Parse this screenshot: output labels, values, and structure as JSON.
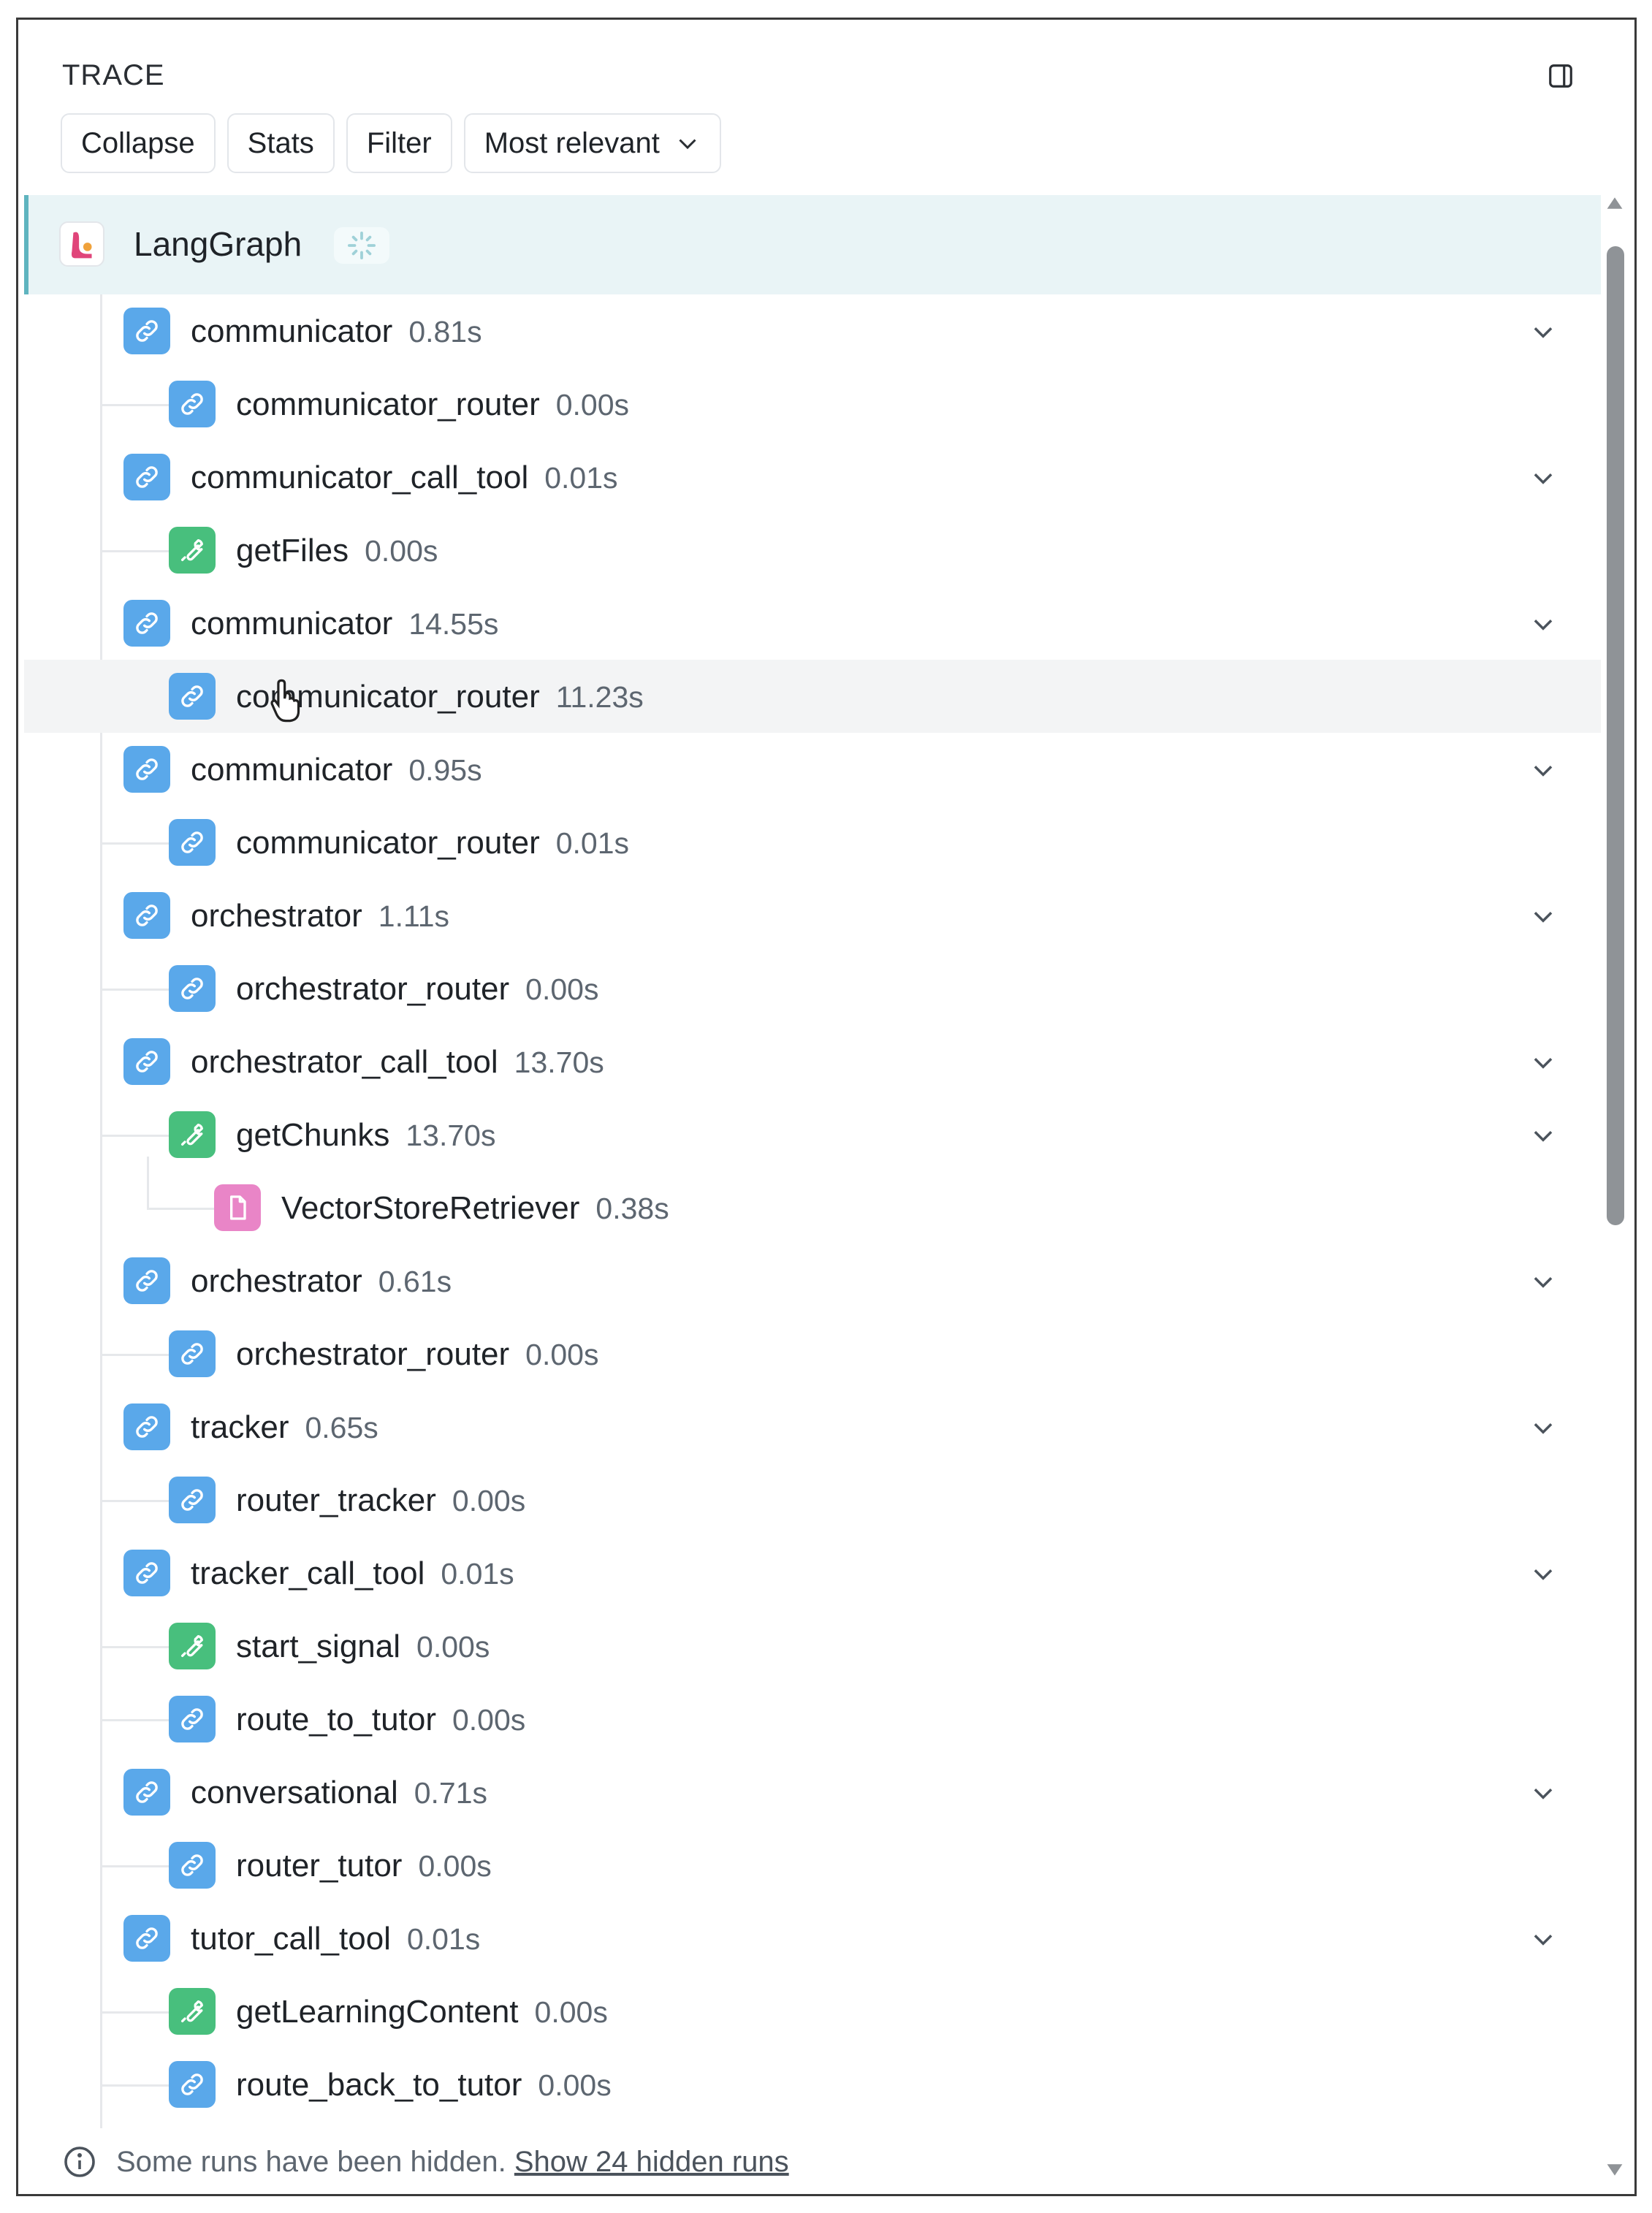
{
  "header": {
    "title": "TRACE",
    "panel_toggle_icon": "panel-right-icon"
  },
  "toolbar": {
    "collapse_label": "Collapse",
    "stats_label": "Stats",
    "filter_label": "Filter",
    "sort_label": "Most relevant",
    "sort_icon": "chevron-down-icon"
  },
  "root": {
    "label": "LangGraph",
    "status_icon": "loading-spinner-icon",
    "logo_icon": "langgraph-logo-icon"
  },
  "runs": [
    {
      "name": "communicator",
      "duration": "0.81s",
      "kind": "chain",
      "depth": 1,
      "expandable": true
    },
    {
      "name": "communicator_router",
      "duration": "0.00s",
      "kind": "chain",
      "depth": 2,
      "expandable": false
    },
    {
      "name": "communicator_call_tool",
      "duration": "0.01s",
      "kind": "chain",
      "depth": 1,
      "expandable": true
    },
    {
      "name": "getFiles",
      "duration": "0.00s",
      "kind": "tool",
      "depth": 2,
      "expandable": false
    },
    {
      "name": "communicator",
      "duration": "14.55s",
      "kind": "chain",
      "depth": 1,
      "expandable": true
    },
    {
      "name": "communicator_router",
      "duration": "11.23s",
      "kind": "chain",
      "depth": 2,
      "expandable": false,
      "hovered": true
    },
    {
      "name": "communicator",
      "duration": "0.95s",
      "kind": "chain",
      "depth": 1,
      "expandable": true
    },
    {
      "name": "communicator_router",
      "duration": "0.01s",
      "kind": "chain",
      "depth": 2,
      "expandable": false
    },
    {
      "name": "orchestrator",
      "duration": "1.11s",
      "kind": "chain",
      "depth": 1,
      "expandable": true
    },
    {
      "name": "orchestrator_router",
      "duration": "0.00s",
      "kind": "chain",
      "depth": 2,
      "expandable": false
    },
    {
      "name": "orchestrator_call_tool",
      "duration": "13.70s",
      "kind": "chain",
      "depth": 1,
      "expandable": true
    },
    {
      "name": "getChunks",
      "duration": "13.70s",
      "kind": "tool",
      "depth": 2,
      "expandable": true
    },
    {
      "name": "VectorStoreRetriever",
      "duration": "0.38s",
      "kind": "retriever",
      "depth": 3,
      "expandable": false
    },
    {
      "name": "orchestrator",
      "duration": "0.61s",
      "kind": "chain",
      "depth": 1,
      "expandable": true
    },
    {
      "name": "orchestrator_router",
      "duration": "0.00s",
      "kind": "chain",
      "depth": 2,
      "expandable": false
    },
    {
      "name": "tracker",
      "duration": "0.65s",
      "kind": "chain",
      "depth": 1,
      "expandable": true
    },
    {
      "name": "router_tracker",
      "duration": "0.00s",
      "kind": "chain",
      "depth": 2,
      "expandable": false
    },
    {
      "name": "tracker_call_tool",
      "duration": "0.01s",
      "kind": "chain",
      "depth": 1,
      "expandable": true
    },
    {
      "name": "start_signal",
      "duration": "0.00s",
      "kind": "tool",
      "depth": 2,
      "expandable": false
    },
    {
      "name": "route_to_tutor",
      "duration": "0.00s",
      "kind": "chain",
      "depth": 2,
      "expandable": false
    },
    {
      "name": "conversational",
      "duration": "0.71s",
      "kind": "chain",
      "depth": 1,
      "expandable": true
    },
    {
      "name": "router_tutor",
      "duration": "0.00s",
      "kind": "chain",
      "depth": 2,
      "expandable": false
    },
    {
      "name": "tutor_call_tool",
      "duration": "0.01s",
      "kind": "chain",
      "depth": 1,
      "expandable": true
    },
    {
      "name": "getLearningContent",
      "duration": "0.00s",
      "kind": "tool",
      "depth": 2,
      "expandable": false
    },
    {
      "name": "route_back_to_tutor",
      "duration": "0.00s",
      "kind": "chain",
      "depth": 2,
      "expandable": false
    }
  ],
  "icons": {
    "chain": "link-icon",
    "tool": "wrench-icon",
    "retriever": "document-icon",
    "expand": "chevron-down-icon"
  },
  "colors": {
    "chain": "#5aa8ea",
    "tool": "#48bf7d",
    "retriever": "#e985c7",
    "root_bg": "#e9f4f6",
    "root_accent": "#5fb4bf"
  },
  "footer": {
    "info_icon": "info-icon",
    "message": "Some runs have been hidden.",
    "link_label": "Show 24 hidden runs"
  }
}
